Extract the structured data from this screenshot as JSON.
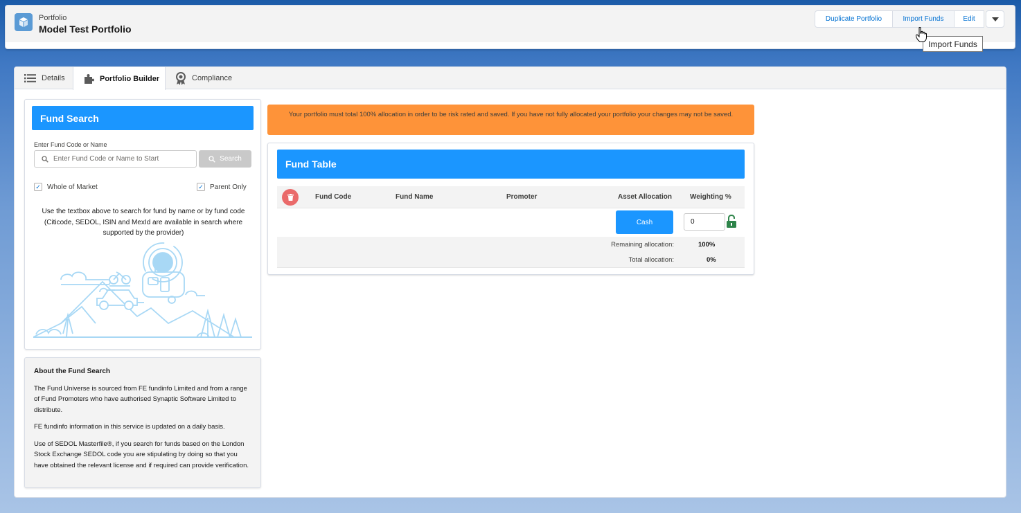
{
  "header": {
    "object_label": "Portfolio",
    "title": "Model Test Portfolio",
    "buttons": {
      "duplicate": "Duplicate Portfolio",
      "import": "Import Funds",
      "edit": "Edit"
    },
    "tooltip": "Import Funds",
    "icon": "cube-icon"
  },
  "tabs": [
    {
      "label": "Details",
      "icon": "list-icon"
    },
    {
      "label": "Portfolio Builder",
      "icon": "puzzle-icon",
      "active": true
    },
    {
      "label": "Compliance",
      "icon": "award-icon"
    }
  ],
  "fund_search": {
    "title": "Fund Search",
    "input_label": "Enter Fund Code or Name",
    "placeholder": "Enter Fund Code or Name to Start",
    "search_button": "Search",
    "whole_of_market": "Whole of Market",
    "parent_only": "Parent Only",
    "help": "Use the textbox above to search for fund by name or by fund code (Citicode, SEDOL, ISIN and MexId are available in search where supported by the provider)"
  },
  "about": {
    "title": "About the Fund Search",
    "p1": "The Fund Universe is sourced from FE fundinfo Limited and from a range of Fund Promoters who have authorised Synaptic Software Limited to distribute.",
    "p2": "FE fundinfo information in this service is updated on a daily basis.",
    "p3": "Use of SEDOL Masterfile®, if you search for funds based on the London Stock Exchange SEDOL code you are stipulating by doing so that you have obtained the relevant license and if required can provide verification."
  },
  "warning": "Your portfolio must total 100% allocation in order to be risk rated and saved. If you have not fully allocated your portfolio your changes may not be saved.",
  "fund_table": {
    "title": "Fund Table",
    "columns": {
      "code": "Fund Code",
      "name": "Fund Name",
      "promoter": "Promoter",
      "allocation": "Asset Allocation",
      "weighting": "Weighting %"
    },
    "cash_button": "Cash",
    "weighting_value": "0",
    "remaining_label": "Remaining allocation:",
    "remaining_value": "100%",
    "total_label": "Total allocation:",
    "total_value": "0%"
  },
  "colors": {
    "brand_blue": "#1b96ff",
    "warning": "#fe9339",
    "delete": "#ea6a6a",
    "lock": "#2e844a"
  }
}
